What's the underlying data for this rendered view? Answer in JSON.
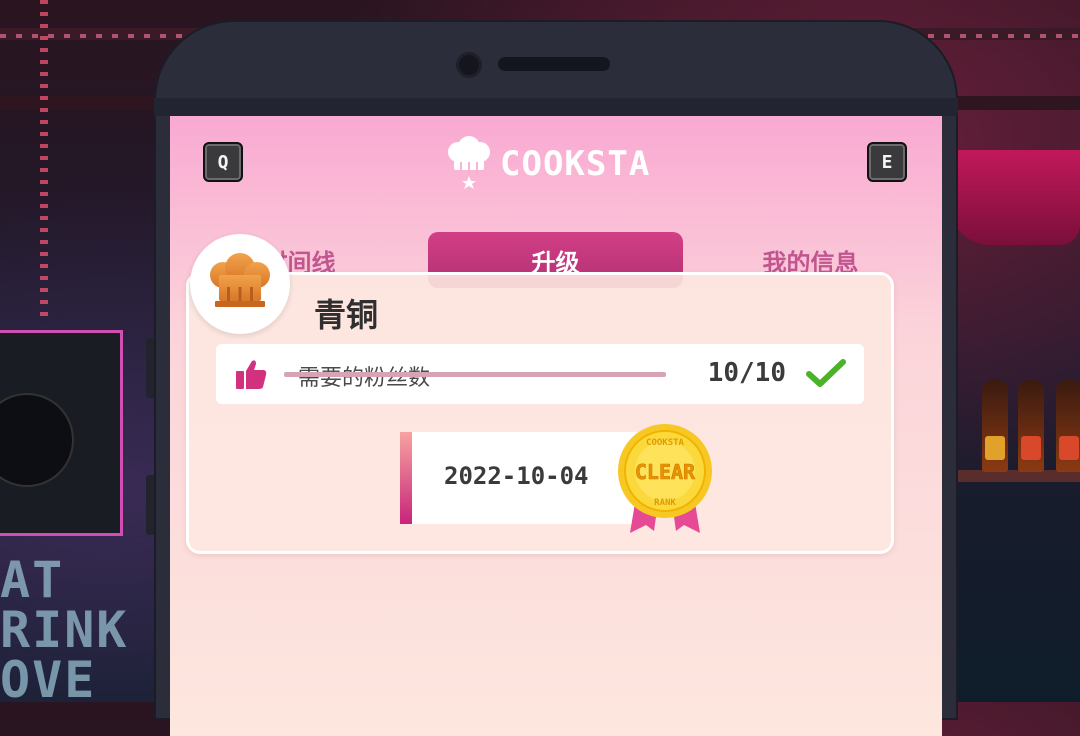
{
  "app": {
    "logo_text": "COOKSTA",
    "logo_icon": "chef-hat-icon"
  },
  "keys": {
    "left": "Q",
    "right": "E"
  },
  "tabs": [
    {
      "label": "时间线",
      "active": false
    },
    {
      "label": "升级",
      "active": true
    },
    {
      "label": "我的信息",
      "active": false
    }
  ],
  "rank": {
    "title": "青铜",
    "icon": "bronze-chef-hat-icon",
    "requirement": {
      "icon": "thumbs-up-icon",
      "label": "需要的粉丝数",
      "count": "10/10",
      "status_icon": "checkmark-icon",
      "completed": true
    },
    "clear_date": "2022-10-04",
    "medal": {
      "top_text": "COOKSTA",
      "center_text": "CLEAR",
      "bottom_text": "RANK"
    }
  },
  "background": {
    "neon_lines": [
      "AT",
      "RINK",
      "OVE"
    ]
  },
  "colors": {
    "accent": "#c8337b",
    "tab_inactive": "#c2558f",
    "check": "#4bb32a",
    "medal_gold": "#f7c823"
  }
}
